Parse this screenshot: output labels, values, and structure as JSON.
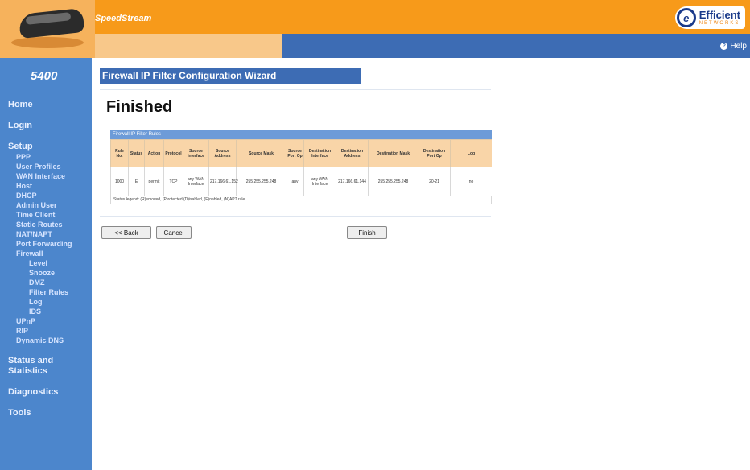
{
  "header": {
    "brand": "SpeedStream",
    "logo_text": "Efficient",
    "logo_subtext": "NETWORKS",
    "logo_letter": "e",
    "help_label": "Help",
    "colors": {
      "orange": "#f79a1a",
      "blue": "#3d6cb4",
      "sidebar": "#4c86cc"
    }
  },
  "sidebar": {
    "model": "5400",
    "items": [
      {
        "label": "Home",
        "level": 0
      },
      {
        "label": "Login",
        "level": 0
      },
      {
        "label": "Setup",
        "level": 0
      },
      {
        "label": "PPP",
        "level": 1
      },
      {
        "label": "User Profiles",
        "level": 1
      },
      {
        "label": "WAN Interface",
        "level": 1
      },
      {
        "label": "Host",
        "level": 1
      },
      {
        "label": "DHCP",
        "level": 1
      },
      {
        "label": "Admin User",
        "level": 1
      },
      {
        "label": "Time Client",
        "level": 1
      },
      {
        "label": "Static Routes",
        "level": 1
      },
      {
        "label": "NAT/NAPT",
        "level": 1
      },
      {
        "label": "Port Forwarding",
        "level": 1
      },
      {
        "label": "Firewall",
        "level": 1
      },
      {
        "label": "Level",
        "level": 2
      },
      {
        "label": "Snooze",
        "level": 2
      },
      {
        "label": "DMZ",
        "level": 2
      },
      {
        "label": "Filter Rules",
        "level": 2
      },
      {
        "label": "Log",
        "level": 2
      },
      {
        "label": "IDS",
        "level": 2
      },
      {
        "label": "UPnP",
        "level": 1
      },
      {
        "label": "RIP",
        "level": 1
      },
      {
        "label": "Dynamic DNS",
        "level": 1
      },
      {
        "label": "Status and Statistics",
        "level": 0
      },
      {
        "label": "Diagnostics",
        "level": 0
      },
      {
        "label": "Tools",
        "level": 0
      }
    ]
  },
  "main": {
    "wizard_title": "Firewall IP Filter Configuration Wizard",
    "heading": "Finished",
    "table_caption": "Firewall IP Filter Rules",
    "columns": [
      "Rule No.",
      "Status",
      "Action",
      "Protocol",
      "Source Interface",
      "Source Address",
      "Source Mask",
      "Source Port Op",
      "Destination Interface",
      "Destination Address",
      "Destination Mask",
      "Destination Port Op",
      "Log"
    ],
    "rows": [
      [
        "1000",
        "E",
        "permit",
        "TCP",
        "any WAN Interface",
        "217.166.61.152",
        "255.255.255.248",
        "any",
        "any WAN Interface",
        "217.166.61.144",
        "255.255.255.248",
        "20-21",
        "no"
      ]
    ],
    "status_legend": "Status legend: (R)emoved, (P)rotected (D)isabled, (E)nabled, (N)APT rule",
    "buttons": {
      "back": "<< Back",
      "cancel": "Cancel",
      "finish": "Finish"
    }
  }
}
